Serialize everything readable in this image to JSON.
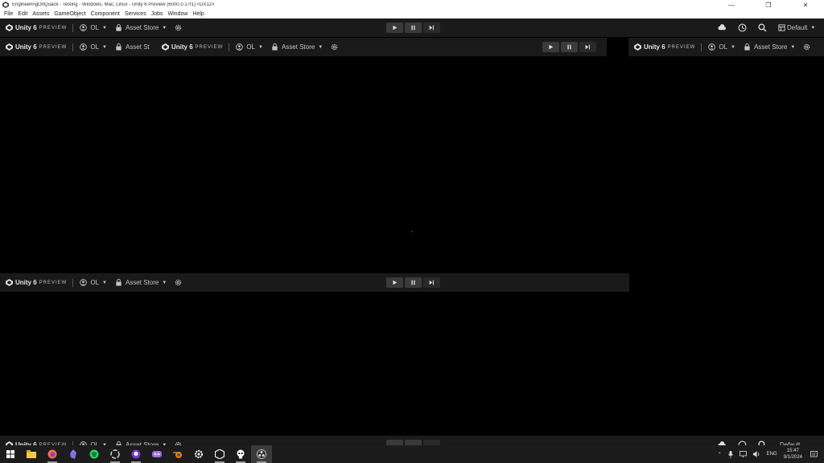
{
  "window": {
    "title": "EngineeringOnQuack - Testing - Windows, Mac, Linux - Unity 6 Preview (6000.0.17f1) <DX12>",
    "minimize_glyph": "—",
    "maximize_glyph": "❐",
    "close_glyph": "✕"
  },
  "menu": [
    "File",
    "Edit",
    "Assets",
    "GameObject",
    "Component",
    "Services",
    "Jobs",
    "Window",
    "Help"
  ],
  "toolbar": {
    "brand": "Unity 6",
    "brand_sub": "PREVIEW",
    "account": "OL",
    "asset_store": "Asset Store",
    "asset_store_truncated": "Asset St",
    "layout": "Default"
  },
  "taskbar": {
    "apps": [
      "file-explorer-icon",
      "firefox-icon",
      "obsidian-icon",
      "spotify-icon",
      "unity-hub-icon",
      "github-icon",
      "discord-like-icon",
      "blender-icon",
      "settings-icon",
      "unity-icon",
      "photo-app-icon",
      "recording-app-icon"
    ],
    "language": "ENG",
    "time": "15:47",
    "date": "9/1/2024"
  },
  "colors": {
    "toolbar_bg": "#1a1a1a",
    "canvas_bg": "#000000",
    "taskbar_bg": "#1c1c1c"
  }
}
